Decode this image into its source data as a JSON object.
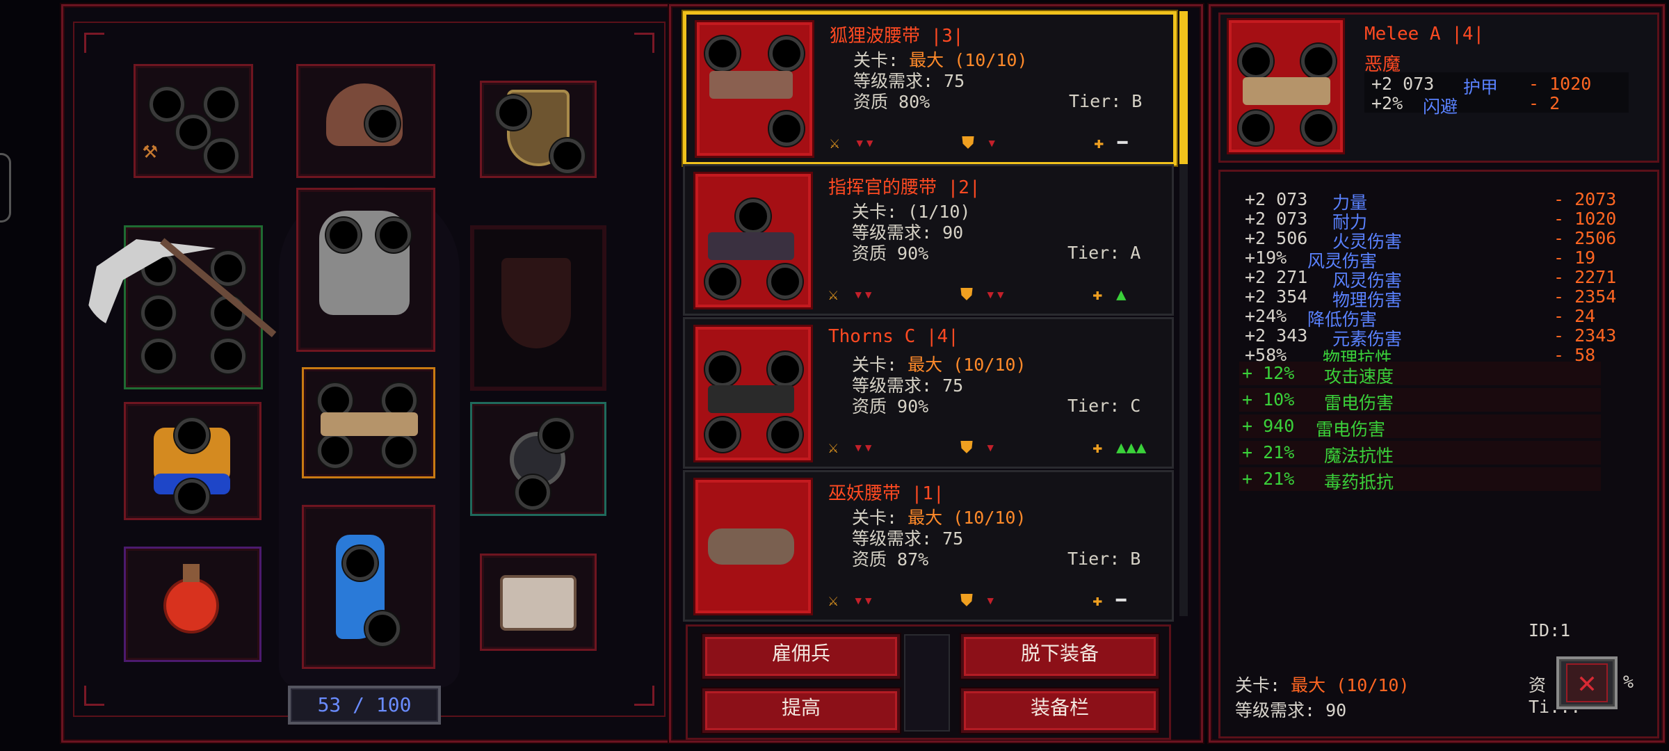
{
  "inventory": {
    "count": "53 / 100"
  },
  "items": [
    {
      "name": "狐狸波腰带 |3|",
      "l1": "关卡: ",
      "l1v": "最大 (10/10)",
      "l2": "等级需求: 75",
      "l3": "资质 80%",
      "tier": "Tier: B",
      "selected": true
    },
    {
      "name": "指挥官的腰带 |2|",
      "l1": "关卡: ",
      "l1v": "(1/10)",
      "l2": "等级需求: 90",
      "l3": "资质 90%",
      "tier": "Tier: A",
      "selected": false
    },
    {
      "name": "Thorns C |4|",
      "l1": "关卡: ",
      "l1v": "最大 (10/10)",
      "l2": "等级需求: 75",
      "l3": "资质 90%",
      "tier": "Tier: C",
      "selected": false
    },
    {
      "name": "巫妖腰带 |1|",
      "l1": "关卡: ",
      "l1v": "最大 (10/10)",
      "l2": "等级需求: 75",
      "l3": "资质 87%",
      "tier": "Tier: B",
      "selected": false
    }
  ],
  "buttons": {
    "hire": "雇佣兵",
    "unequip": "脱下装备",
    "upgrade": "提高",
    "equipment_bar": "装备栏"
  },
  "detail": {
    "name": "Melee A |4|",
    "subtitle": "恶魔",
    "main_stats": [
      {
        "value": "+2 073",
        "label": "护甲",
        "diff": "- 1020"
      },
      {
        "value": "+2%",
        "label": "闪避",
        "diff": "- 2"
      }
    ],
    "stats": [
      {
        "value": "+2 073",
        "label": "力量",
        "diff": "- 2073"
      },
      {
        "value": "+2 073",
        "label": "耐力",
        "diff": "- 1020"
      },
      {
        "value": "+2 506",
        "label": "火灵伤害",
        "diff": "- 2506"
      },
      {
        "value": "+19%",
        "label": "风灵伤害",
        "diff": "- 19"
      },
      {
        "value": "+2 271",
        "label": "风灵伤害",
        "diff": "- 2271"
      },
      {
        "value": "+2 354",
        "label": "物理伤害",
        "diff": "- 2354"
      },
      {
        "value": "+24%",
        "label": "降低伤害",
        "diff": "- 24"
      },
      {
        "value": "+2 343",
        "label": "元素伤害",
        "diff": "- 2343"
      },
      {
        "value": "+58%",
        "label": "物理抗性",
        "diff": "- 58"
      }
    ],
    "bonus_stats": [
      {
        "value": "+ 12%",
        "label": "攻击速度"
      },
      {
        "value": "+ 10%",
        "label": "雷电伤害"
      },
      {
        "value": "+ 940",
        "label": "雷电伤害"
      },
      {
        "value": "+ 21%",
        "label": "魔法抗性"
      },
      {
        "value": "+ 21%",
        "label": "毒药抵抗"
      }
    ],
    "id": "ID:1",
    "level_label": "关卡: ",
    "level_value": "最大 (10/10)",
    "level_req": "等级需求: 90",
    "quality_partial": "资",
    "quality_pct": "%",
    "tier_partial": "Ti..."
  },
  "colors": {
    "accent_red": "#a50f14",
    "selected_gold": "#f1c21c",
    "stat_blue": "#5a82ff",
    "stat_orange": "#ff6622",
    "stat_green": "#3ad13a"
  }
}
